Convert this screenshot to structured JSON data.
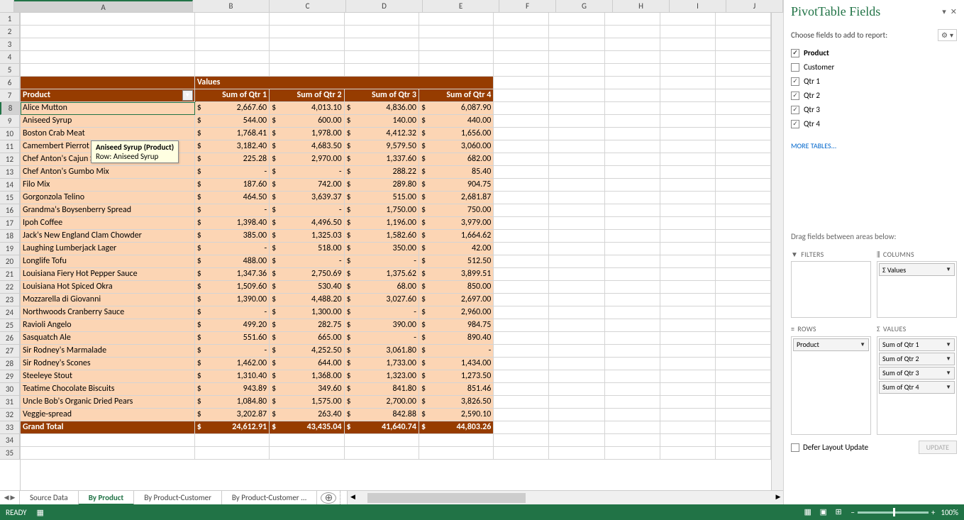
{
  "panel": {
    "title": "PivotTable Fields",
    "subtitle": "Choose fields to add to report:",
    "more_tables": "MORE TABLES...",
    "drag_label": "Drag fields between areas below:",
    "defer_label": "Defer Layout Update",
    "update_btn": "UPDATE"
  },
  "area_headers": {
    "filters": "FILTERS",
    "columns": "COLUMNS",
    "rows": "ROWS",
    "values": "VALUES"
  },
  "area_items": {
    "columns": [
      "Σ Values"
    ],
    "rows": [
      "Product"
    ],
    "values": [
      "Sum of Qtr 1",
      "Sum of Qtr 2",
      "Sum of Qtr 3",
      "Sum of Qtr 4"
    ]
  },
  "fields": [
    {
      "label": "Product",
      "checked": true,
      "bold": true
    },
    {
      "label": "Customer",
      "checked": false,
      "bold": false
    },
    {
      "label": "Qtr 1",
      "checked": true,
      "bold": false
    },
    {
      "label": "Qtr 2",
      "checked": true,
      "bold": false
    },
    {
      "label": "Qtr 3",
      "checked": true,
      "bold": false
    },
    {
      "label": "Qtr 4",
      "checked": true,
      "bold": false
    }
  ],
  "columns_letters": [
    "A",
    "B",
    "C",
    "D",
    "E",
    "F",
    "G",
    "H",
    "I",
    "J"
  ],
  "pivot": {
    "values_label": "Values",
    "row_header": "Product",
    "col_headers": [
      "Sum of Qtr 1",
      "Sum of Qtr 2",
      "Sum of Qtr 3",
      "Sum of Qtr 4"
    ],
    "grand_total": "Grand Total",
    "grand_values": [
      "24,612.91",
      "43,435.04",
      "41,640.74",
      "44,803.26"
    ],
    "rows": [
      {
        "p": "Alice Mutton",
        "v": [
          "2,667.60",
          "4,013.10",
          "4,836.00",
          "6,087.90"
        ]
      },
      {
        "p": "Aniseed Syrup",
        "v": [
          "544.00",
          "600.00",
          "140.00",
          "440.00"
        ]
      },
      {
        "p": "Boston Crab Meat",
        "v": [
          "1,768.41",
          "1,978.00",
          "4,412.32",
          "1,656.00"
        ]
      },
      {
        "p": "Camembert Pierrot",
        "v": [
          "3,182.40",
          "4,683.50",
          "9,579.50",
          "3,060.00"
        ]
      },
      {
        "p": "Chef Anton's Cajun Seasoning",
        "v": [
          "225.28",
          "2,970.00",
          "1,337.60",
          "682.00"
        ]
      },
      {
        "p": "Chef Anton's Gumbo Mix",
        "v": [
          "-",
          "-",
          "288.22",
          "85.40"
        ]
      },
      {
        "p": "Filo Mix",
        "v": [
          "187.60",
          "742.00",
          "289.80",
          "904.75"
        ]
      },
      {
        "p": "Gorgonzola Telino",
        "v": [
          "464.50",
          "3,639.37",
          "515.00",
          "2,681.87"
        ]
      },
      {
        "p": "Grandma's Boysenberry Spread",
        "v": [
          "-",
          "-",
          "1,750.00",
          "750.00"
        ]
      },
      {
        "p": "Ipoh Coffee",
        "v": [
          "1,398.40",
          "4,496.50",
          "1,196.00",
          "3,979.00"
        ]
      },
      {
        "p": "Jack's New England Clam Chowder",
        "v": [
          "385.00",
          "1,325.03",
          "1,582.60",
          "1,664.62"
        ]
      },
      {
        "p": "Laughing Lumberjack Lager",
        "v": [
          "-",
          "518.00",
          "350.00",
          "42.00"
        ]
      },
      {
        "p": "Longlife Tofu",
        "v": [
          "488.00",
          "-",
          "-",
          "512.50"
        ]
      },
      {
        "p": "Louisiana Fiery Hot Pepper Sauce",
        "v": [
          "1,347.36",
          "2,750.69",
          "1,375.62",
          "3,899.51"
        ]
      },
      {
        "p": "Louisiana Hot Spiced Okra",
        "v": [
          "1,509.60",
          "530.40",
          "68.00",
          "850.00"
        ]
      },
      {
        "p": "Mozzarella di Giovanni",
        "v": [
          "1,390.00",
          "4,488.20",
          "3,027.60",
          "2,697.00"
        ]
      },
      {
        "p": "Northwoods Cranberry Sauce",
        "v": [
          "-",
          "1,300.00",
          "-",
          "2,960.00"
        ]
      },
      {
        "p": "Ravioli Angelo",
        "v": [
          "499.20",
          "282.75",
          "390.00",
          "984.75"
        ]
      },
      {
        "p": "Sasquatch Ale",
        "v": [
          "551.60",
          "665.00",
          "-",
          "890.40"
        ]
      },
      {
        "p": "Sir Rodney's Marmalade",
        "v": [
          "-",
          "4,252.50",
          "3,061.80",
          "-"
        ]
      },
      {
        "p": "Sir Rodney's Scones",
        "v": [
          "1,462.00",
          "644.00",
          "1,733.00",
          "1,434.00"
        ]
      },
      {
        "p": "Steeleye Stout",
        "v": [
          "1,310.40",
          "1,368.00",
          "1,323.00",
          "1,273.50"
        ]
      },
      {
        "p": "Teatime Chocolate Biscuits",
        "v": [
          "943.89",
          "349.60",
          "841.80",
          "851.46"
        ]
      },
      {
        "p": "Uncle Bob's Organic Dried Pears",
        "v": [
          "1,084.80",
          "1,575.00",
          "2,700.00",
          "3,826.50"
        ]
      },
      {
        "p": "Veggie-spread",
        "v": [
          "3,202.87",
          "263.40",
          "842.88",
          "2,590.10"
        ]
      }
    ]
  },
  "tooltip": {
    "title": "Aniseed Syrup (Product)",
    "row": "Row: Aniseed Syrup"
  },
  "tabs": [
    "Source Data",
    "By Product",
    "By Product-Customer",
    "By Product-Customer  ..."
  ],
  "active_tab": 1,
  "status": {
    "ready": "READY",
    "zoom": "100%"
  }
}
